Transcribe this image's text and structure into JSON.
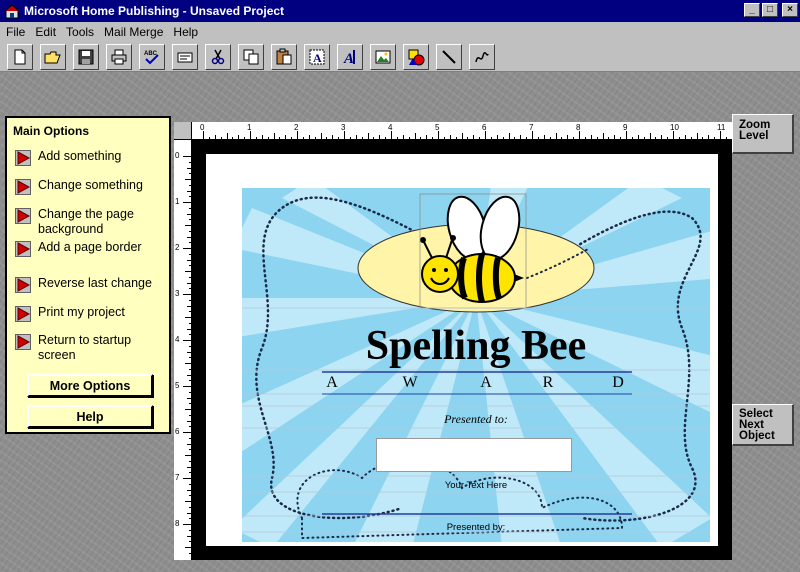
{
  "window": {
    "title": "Microsoft Home Publishing - Unsaved Project",
    "app_icon": "home-publishing-icon",
    "controls": [
      "_",
      "□",
      "×"
    ]
  },
  "menu": {
    "items": [
      "File",
      "Edit",
      "Tools",
      "Mail Merge",
      "Help"
    ]
  },
  "toolbar": {
    "icons": [
      "new-icon",
      "open-icon",
      "save-icon",
      "print-icon",
      "spellcheck-icon",
      "caption-icon",
      "cut-icon",
      "copy-icon",
      "paste-icon",
      "text-frame-icon",
      "wordart-icon",
      "picture-icon",
      "shapes-icon",
      "line-icon",
      "draw-icon"
    ]
  },
  "main_options": {
    "title": "Main Options",
    "items": [
      "Add something",
      "Change something",
      "Change the page background",
      "Add a page border",
      "Reverse last change",
      "Print my project",
      "Return to startup screen"
    ],
    "more_options_label": "More Options",
    "help_label": "Help"
  },
  "side_buttons": {
    "zoom_line1": "Zoom",
    "zoom_line2": "Level",
    "select_line1": "Select",
    "select_line2": "Next",
    "select_line3": "Object"
  },
  "ruler": {
    "h_numbers": [
      "0",
      "1",
      "2",
      "3",
      "4",
      "5",
      "6",
      "7",
      "8",
      "9",
      "10",
      "11"
    ],
    "v_numbers": [
      "0",
      "1",
      "2",
      "3",
      "4",
      "5",
      "6",
      "7",
      "8"
    ]
  },
  "certificate": {
    "title": "Spelling Bee",
    "award_letters": [
      "A",
      "W",
      "A",
      "R",
      "D"
    ],
    "presented_to": "Presented to:",
    "your_text": "Your Text Here",
    "presented_by": "Presented by:"
  },
  "colors": {
    "title_bar": "#000080",
    "panel_bg": "#ffffc0",
    "cert_sky": "#8cd4ef",
    "cert_rays": "#bfe8f8",
    "oval": "#fff4a8",
    "bee_yellow": "#ffe400"
  }
}
